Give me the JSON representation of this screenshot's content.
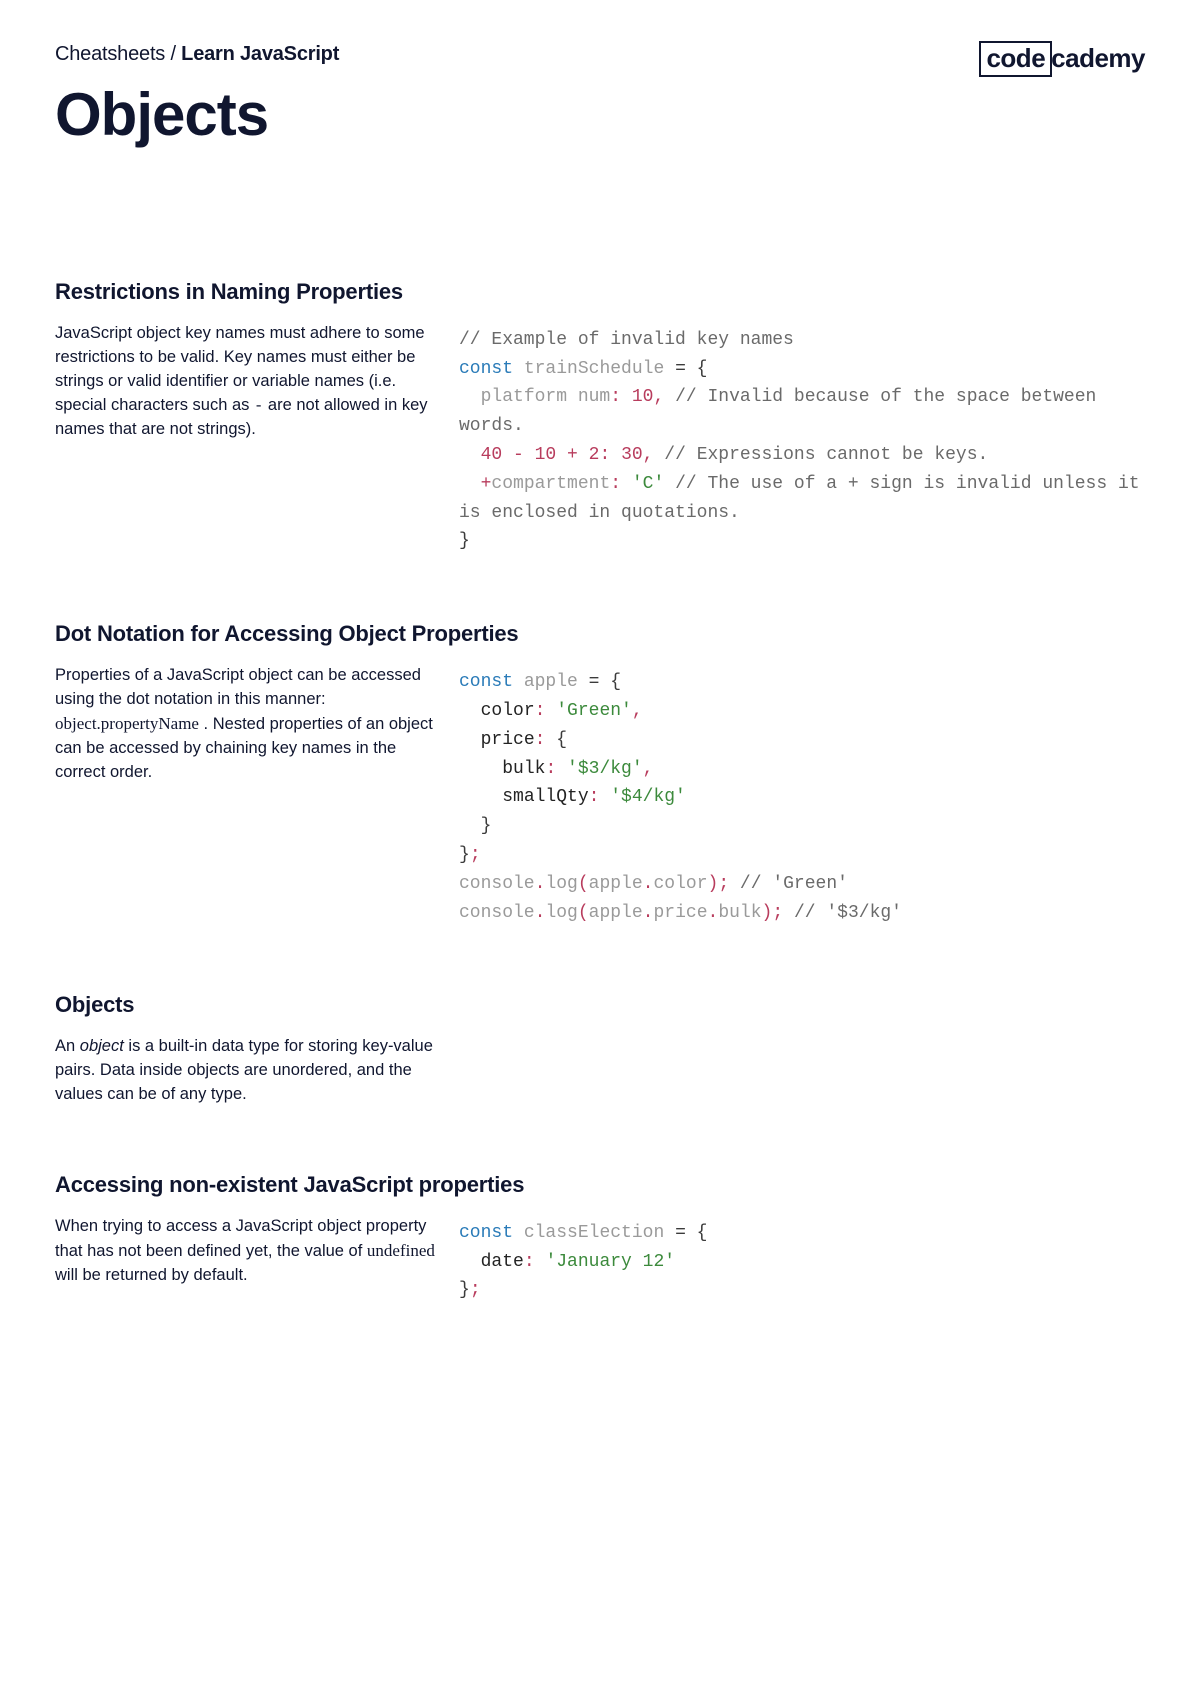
{
  "breadcrumb": {
    "prefix": "Cheatsheets / ",
    "bold": "Learn JavaScript"
  },
  "title": "Objects",
  "logo": {
    "box": "code",
    "rest": "cademy"
  },
  "sections": {
    "s1": {
      "title": "Restrictions in Naming Properties",
      "p1": "JavaScript object key names must adhere to some restrictions to be valid. Key names must either be strings or valid identifier or variable names (i.e. special characters such as ",
      "dash": "-",
      "p2": " are not allowed in key names that are not strings).",
      "code": {
        "c1": "// Example of invalid key names",
        "kw": "const",
        "var": "trainSchedule",
        "eq": " = ",
        "lb": "{",
        "pn": "platform num",
        "col": ": ",
        "v1": "10",
        "comma": ",",
        "cmt1": " // Invalid because of the space between words.",
        "n1": "40",
        "minus": " - ",
        "n2": "10",
        "plus": " + ",
        "n3": "2",
        "v2": "30",
        "cmt2": " // Expressions cannot be keys.",
        "op_plus": "+",
        "comp": "compartment",
        "v3": "'C'",
        "cmt3": " // The use of a + sign is invalid unless it is enclosed in quotations.",
        "rb": "}"
      }
    },
    "s2": {
      "title": "Dot Notation for Accessing Object Properties",
      "p1": "Properties of a JavaScript object can be accessed using the dot notation in this manner: ",
      "mono": "object.propertyName",
      "p2": " . Nested properties of an object can be accessed by chaining key names in the correct order.",
      "code": {
        "kw": "const",
        "var": "apple",
        "eq": " = ",
        "lb": "{",
        "p_color": "color",
        "col": ": ",
        "v_color": "'Green'",
        "comma": ",",
        "p_price": "price",
        "lb2": "{",
        "p_bulk": "bulk",
        "v_bulk": "'$3/kg'",
        "p_small": "smallQty",
        "v_small": "'$4/kg'",
        "rb2": "}",
        "rb": "}",
        "semi": ";",
        "console1a": "console",
        "dot": ".",
        "log": "log",
        "lp": "(",
        "apple1": "apple",
        "color1": "color",
        "rp": ")",
        "cmt1": " // 'Green'",
        "price1": "price",
        "bulk1": "bulk",
        "cmt2": " // '$3/kg'"
      }
    },
    "s3": {
      "title": "Objects",
      "p1": "An ",
      "it": "object",
      "p2": " is a built-in data type for storing key-value pairs. Data inside objects are unordered, and the values can be of any type."
    },
    "s4": {
      "title": "Accessing non-existent JavaScript properties",
      "p1": "When trying to access a JavaScript object property that has not been defined yet, the value of ",
      "mono": "undefined",
      "p2": " will be returned by default.",
      "code": {
        "kw": "const",
        "var": "classElection",
        "eq": " = ",
        "lb": "{",
        "p_date": "date",
        "col": ": ",
        "v_date": "'January 12'",
        "rb": "}",
        "semi": ";"
      }
    }
  }
}
